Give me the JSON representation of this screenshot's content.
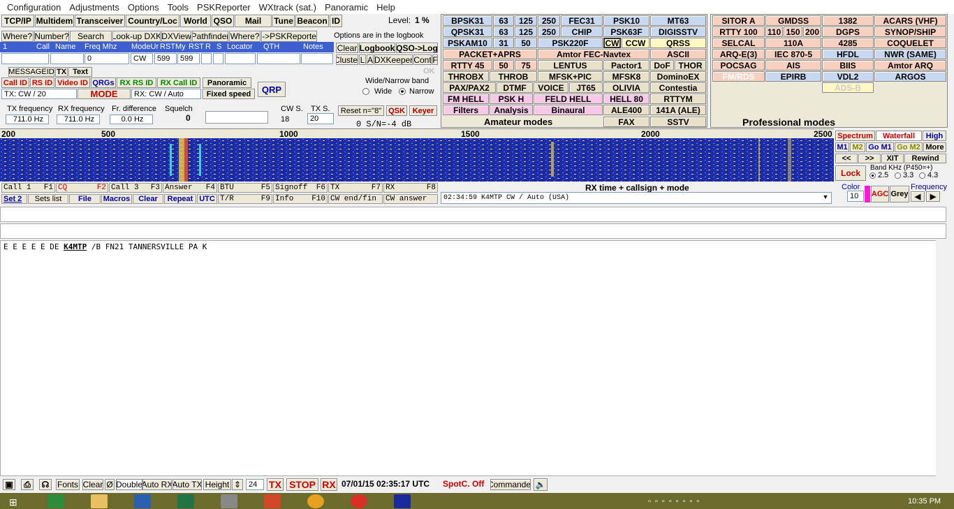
{
  "menu": [
    "Configuration",
    "Adjustments",
    "Options",
    "Tools",
    "PSKReporter",
    "WXtrack (sat.)",
    "Panoramic",
    "Help"
  ],
  "toolbar1": [
    "TCP/IP",
    "Multidem",
    "Transceiver",
    "Country/Loc",
    "World",
    "QSO",
    "Mail",
    "Tune",
    "Beacon",
    "ID"
  ],
  "level": {
    "label": "Level:",
    "value": "1 %"
  },
  "toolbar2": [
    "Where?",
    "Number?",
    "Search",
    "Look-up DXK",
    "DXView",
    "Pathfinder",
    "Where?",
    "-->PSKReporter"
  ],
  "options_note": "Options are in the logbook",
  "log_headers": [
    "Call",
    "Name",
    "Freq Mhz",
    "ModeUr",
    "RSTMy",
    "RST",
    "R",
    "S",
    "Locator",
    "QTH",
    "Notes"
  ],
  "log": {
    "num": "1",
    "freq": "0",
    "mode": "CW",
    "rst_ur": "599",
    "rst_my": "599"
  },
  "log_buttons": {
    "clear": "Clear",
    "logbook": "Logbook",
    "qso_log": "QSO->Log",
    "cluster": "Cluster",
    "l": "L",
    "a": "A",
    "dxkeeper": "DXKeeper",
    "cont": "Cont",
    "f": "F"
  },
  "tabs": [
    "MESSAGEID",
    "TX",
    "Text"
  ],
  "ok": "OK",
  "ids": {
    "call_id": "Call ID",
    "rs_id": "RS ID",
    "video_id": "Video ID",
    "qrgs": "QRGs",
    "rx_rs_id": "RX RS ID",
    "rx_call_id": "RX Call ID",
    "panoramic": "Panoramic",
    "fixed_speed": "Fixed speed",
    "qrp": "QRP"
  },
  "mode_row": {
    "tx": "TX: CW / 20",
    "mode": "MODE",
    "rx": "RX: CW / Auto"
  },
  "band": {
    "title": "Wide/Narrow band",
    "wide": "Wide",
    "narrow": "Narrow"
  },
  "freq": {
    "tx_label": "TX frequency",
    "tx": "711.0 Hz",
    "rx_label": "RX frequency",
    "rx": "711.0 Hz",
    "diff_label": "Fr. difference",
    "diff": "0.0 Hz",
    "squelch_label": "Squelch",
    "squelch": "0",
    "cw_label": "CW S.",
    "cw": "18",
    "txs_label": "TX S.",
    "txs": "20",
    "reset": "Reset n=\"8\"",
    "qsk": "QSK",
    "keyer": "Keyer",
    "sn": "0   S/N=-4 dB"
  },
  "amateur_modes": [
    [
      "BPSK31",
      "63",
      "125",
      "250",
      "FEC31",
      "PSK10",
      "MT63"
    ],
    [
      "QPSK31",
      "63",
      "125",
      "250",
      "CHIP",
      "PSK63F",
      "DIGISSTV"
    ],
    [
      "PSKAM10",
      "31",
      "50",
      "PSK220F",
      "CW",
      "CCW",
      "QRSS"
    ],
    [
      "PACKET+APRS",
      "Amtor FEC-Navtex",
      "ASCII"
    ],
    [
      "RTTY 45",
      "50",
      "75",
      "LENTUS",
      "Pactor1",
      "DoF",
      "THOR"
    ],
    [
      "THROBX",
      "THROB",
      "MFSK+PIC",
      "MFSK8",
      "DominoEX"
    ],
    [
      "PAX/PAX2",
      "DTMF",
      "VOICE",
      "JT65",
      "OLIVIA",
      "Contestia"
    ],
    [
      "FM HELL",
      "PSK H",
      "FELD HELL",
      "HELL 80",
      "RTTYM"
    ],
    [
      "Filters",
      "Analysis",
      "Binaural",
      "ALE400",
      "141A (ALE)"
    ],
    [
      "FAX",
      "SSTV"
    ]
  ],
  "amateur_label": "Amateur modes",
  "pro_modes": [
    [
      "SITOR A",
      "GMDSS",
      "1382",
      "ACARS (VHF)"
    ],
    [
      "RTTY 100",
      "110",
      "150",
      "200",
      "DGPS",
      "SYNOP/SHIP"
    ],
    [
      "SELCAL",
      "110A",
      "4285",
      "COQUELET"
    ],
    [
      "ARQ-E(3)",
      "IEC 870-5",
      "HFDL",
      "NWR (SAME)"
    ],
    [
      "POCSAG",
      "AIS",
      "BIIS",
      "Amtor ARQ"
    ],
    [
      "FM/RDS",
      "EPIRB",
      "VDL2",
      "ARGOS"
    ],
    [
      "ADS-B"
    ]
  ],
  "pro_label": "Professional modes",
  "scale": [
    "200",
    "500",
    "1000",
    "1500",
    "2000",
    "2500"
  ],
  "side_controls": {
    "spectrum": "Spectrum",
    "waterfall": "Waterfall",
    "high": "High",
    "m1": "M1",
    "m2": "M2",
    "gom1": "Go M1",
    "gom2": "Go M2",
    "more": "More",
    "prev": "<<",
    "next": ">>",
    "xit": "XIT",
    "rewind": "Rewind",
    "lock": "Lock",
    "bandkhz": "Band KHz (P450=+)",
    "b1": "2.5",
    "b2": "3.3",
    "b3": "4.3",
    "color": "Color",
    "color_val": "10",
    "agc": "AGC",
    "grey": "Grey",
    "frequency": "Frequency"
  },
  "fkeys": [
    [
      "Call 1",
      "F1"
    ],
    [
      "CQ",
      "F2"
    ],
    [
      "Call 3",
      "F3"
    ],
    [
      "Answer",
      "F4"
    ],
    [
      "BTU",
      "F5"
    ],
    [
      "Signoff",
      "F6"
    ],
    [
      "TX",
      "F7"
    ],
    [
      "RX",
      "F8"
    ]
  ],
  "fkeys2": [
    "Set 2",
    "Sets list",
    "File",
    "Macros",
    "Clear",
    "Repeat",
    "UTC"
  ],
  "fkeys3": [
    [
      "T/R",
      "F9"
    ],
    [
      "Info",
      "F10"
    ],
    [
      "CW end/fin",
      ""
    ],
    [
      "CW answer",
      ""
    ]
  ],
  "rx_header": "RX time + callsign + mode",
  "rx_entry": "02:34:59 K4MTP        CW / Auto (USA)",
  "rx_text": {
    "pre": "E E E E E DE ",
    "call": "K4MTP",
    "post": " /B FN21 TANNERSVILLE PA K"
  },
  "bottom": {
    "fonts": "Fonts",
    "clear": "Clear",
    "zero": "Ø",
    "double": "Double",
    "autorx": "Auto RX",
    "autotx": "Auto TX",
    "height": "Height",
    "height_val": "24",
    "tx": "TX",
    "stop": "STOP",
    "rx": "RX",
    "datetime": "07/01/15 02:35:17 UTC",
    "spotc": "SpotC. Off",
    "commander": "Commander"
  },
  "clock": "10:35 PM"
}
